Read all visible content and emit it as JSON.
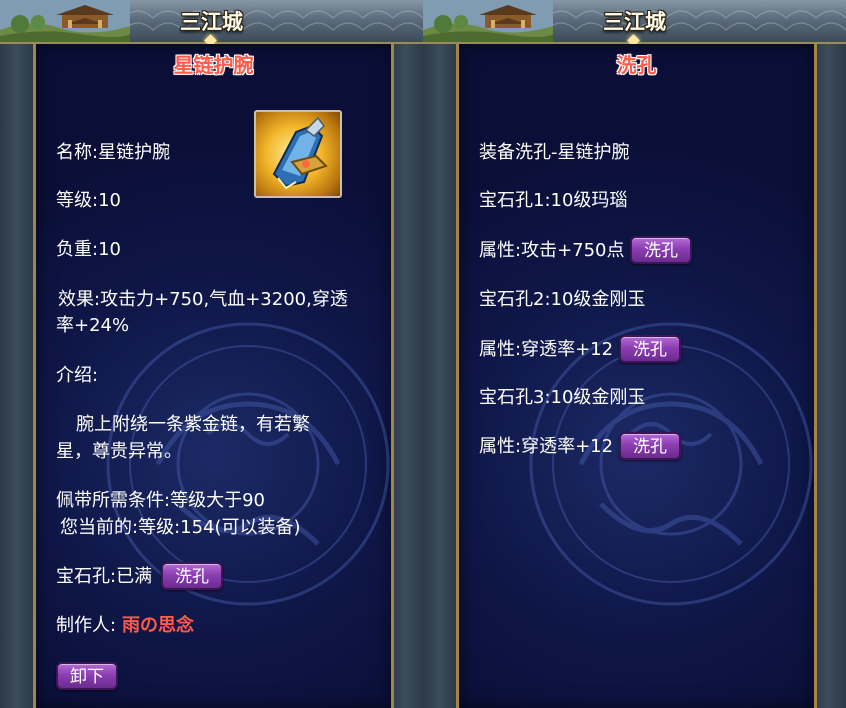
{
  "left": {
    "city_name": "三江城",
    "title": "星链护腕",
    "name": "名称:星链护腕",
    "level": "等级:10",
    "weight": "负重:10",
    "effect_line1": "效果:攻击力+750,气血+3200,穿透",
    "effect_line2": "率+24%",
    "intro_label": "介绍:",
    "intro_line1": "腕上附绕一条紫金链，有若繁",
    "intro_line2": "星，尊贵异常。",
    "req_line1": "佩带所需条件:等级大于90",
    "req_line2": "您当前的:等级:154(可以装备)",
    "gem_label": "宝石孔:已满",
    "wash_button": "洗孔",
    "maker_label": "制作人:",
    "maker_name": "雨の思念",
    "unequip_button": "卸下",
    "item_icon": "armor-bracer-icon"
  },
  "right": {
    "city_name": "三江城",
    "title": "洗孔",
    "header": "装备洗孔-星链护腕",
    "holes": [
      {
        "hole": "宝石孔1:10级玛瑙",
        "attr": "属性:攻击+750点",
        "button": "洗孔"
      },
      {
        "hole": "宝石孔2:10级金刚玉",
        "attr": "属性:穿透率+12",
        "button": "洗孔"
      },
      {
        "hole": "宝石孔3:10级金刚玉",
        "attr": "属性:穿透率+12",
        "button": "洗孔"
      }
    ]
  },
  "colors": {
    "panel_bg": "#0b0f38",
    "panel_border": "#a38646",
    "title_red": "#ff5a4a",
    "button_purple": "#8b3fb2",
    "text": "#ffffff"
  }
}
